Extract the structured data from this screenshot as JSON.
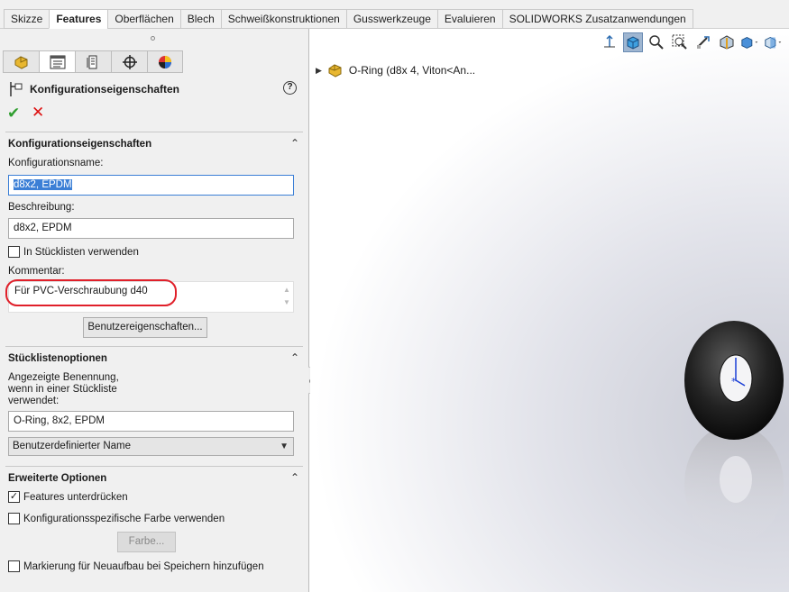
{
  "ribbon": {
    "tabs": [
      "Skizze",
      "Features",
      "Oberflächen",
      "Blech",
      "Schweißkonstruktionen",
      "Gusswerkzeuge",
      "Evaluieren",
      "SOLIDWORKS Zusatzanwendungen"
    ],
    "active_tab": "Features"
  },
  "property_manager": {
    "title": "Konfigurationseigenschaften",
    "help": "?",
    "ok_symbol": "✔",
    "cancel_symbol": "✕",
    "config_section": {
      "header": "Konfigurationseigenschaften",
      "name_label": "Konfigurationsname:",
      "name_value": "d8x2, EPDM",
      "description_label": "Beschreibung:",
      "description_value": "d8x2, EPDM",
      "use_in_bom_label": "In Stücklisten verwenden",
      "use_in_bom_checked": false,
      "comment_label": "Kommentar:",
      "comment_value": "Für PVC-Verschraubung d40",
      "custom_props_button": "Benutzereigenschaften..."
    },
    "bom_section": {
      "header": "Stücklistenoptionen",
      "displayed_name_label_1": "Angezeigte Benennung,",
      "displayed_name_label_2": "wenn in einer Stückliste",
      "displayed_name_label_3": "verwendet:",
      "displayed_name_value": "O-Ring, 8x2, EPDM",
      "name_mode_selected": "Benutzerdefinierter Name"
    },
    "advanced_section": {
      "header": "Erweiterte Optionen",
      "suppress_features_label": "Features unterdrücken",
      "suppress_features_checked": true,
      "config_color_label": "Konfigurationsspezifische Farbe verwenden",
      "config_color_checked": false,
      "color_button": "Farbe...",
      "rebuild_mark_label": "Markierung für Neuaufbau bei Speichern hinzufügen",
      "rebuild_mark_checked": false
    }
  },
  "graphics": {
    "tree_item": "O-Ring  (d8x 4, Viton<An..."
  },
  "colors": {
    "accent": "#3b7fd6",
    "annotation_red": "#e0202a",
    "ok_green": "#2f9e2f",
    "cancel_red": "#dd1111"
  }
}
